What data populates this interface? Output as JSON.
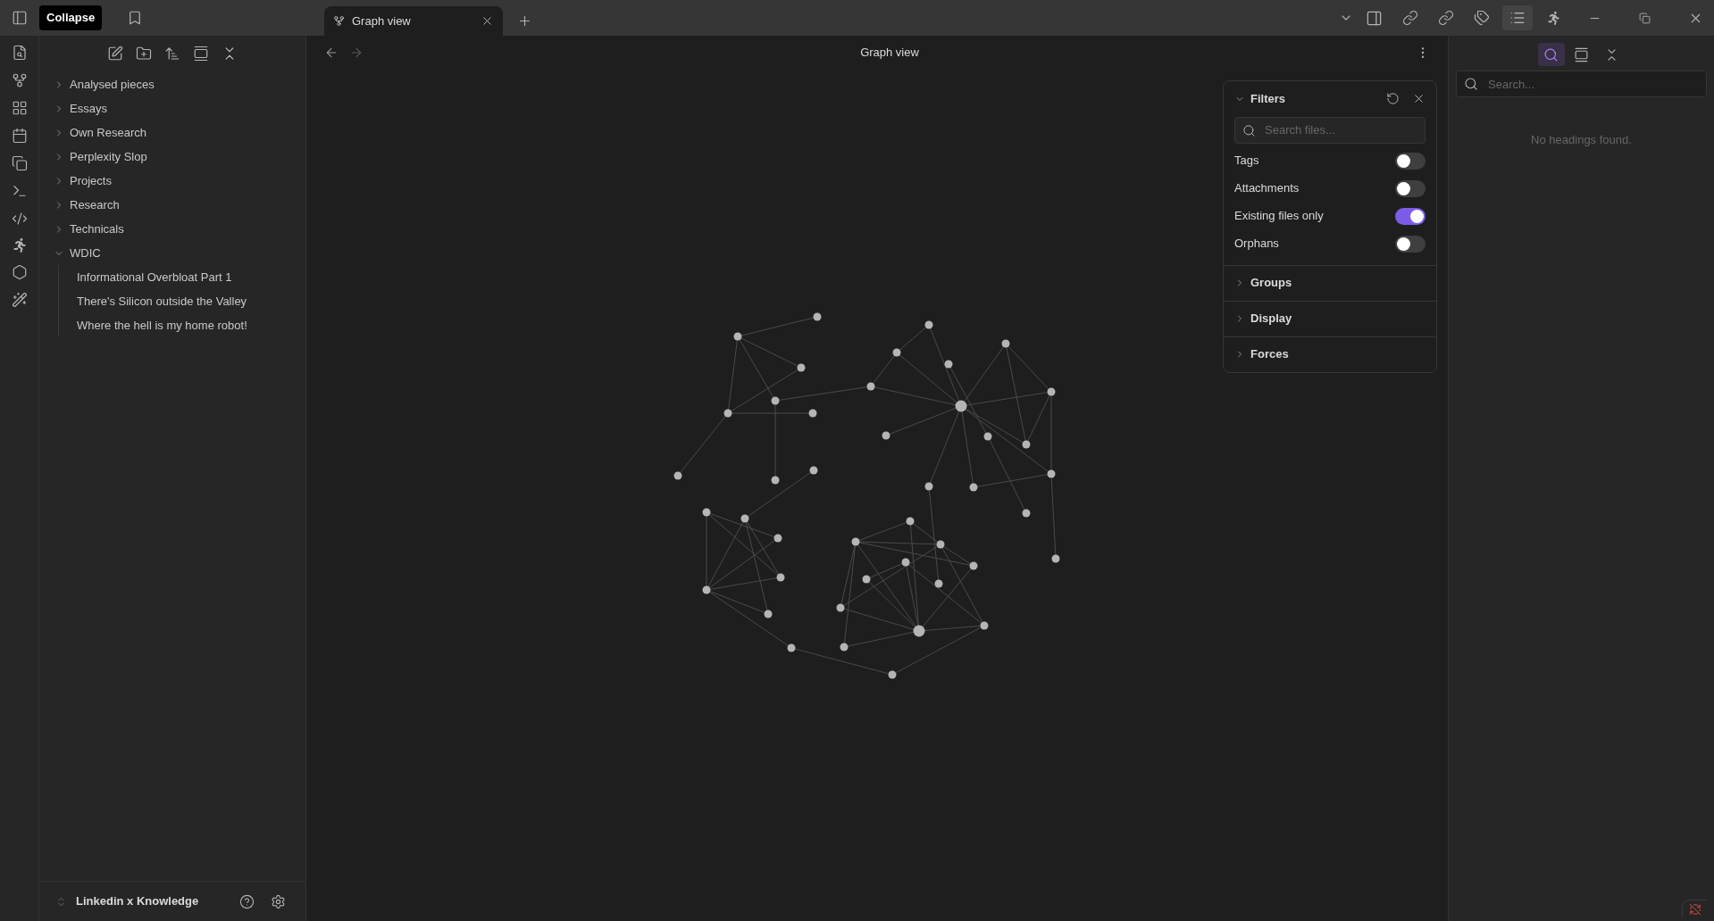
{
  "titlebar": {
    "tooltip": "Collapse",
    "tabs": [
      {
        "label": "Graph view",
        "selected": true
      }
    ],
    "sidebar_tabs": [
      {
        "kind": "backlinks",
        "selected": false
      },
      {
        "kind": "outgoing",
        "selected": false
      },
      {
        "kind": "tags",
        "selected": false
      },
      {
        "kind": "outline",
        "selected": true
      },
      {
        "kind": "runner",
        "selected": false
      }
    ]
  },
  "file_tree": [
    {
      "label": "Analysed pieces",
      "expanded": false
    },
    {
      "label": "Essays",
      "expanded": false
    },
    {
      "label": "Own Research",
      "expanded": false
    },
    {
      "label": "Perplexity Slop",
      "expanded": false
    },
    {
      "label": "Projects",
      "expanded": false
    },
    {
      "label": "Research",
      "expanded": false
    },
    {
      "label": "Technicals",
      "expanded": false
    },
    {
      "label": "WDIC",
      "expanded": true,
      "children": [
        {
          "label": "Informational Overbloat Part 1"
        },
        {
          "label": "There's Silicon outside the Valley"
        },
        {
          "label": "Where the hell is my home robot!"
        }
      ]
    }
  ],
  "vault": {
    "name": "Linkedin x Knowledge"
  },
  "graph_view": {
    "title": "Graph view"
  },
  "filters": {
    "title": "Filters",
    "expanded": true,
    "search": {
      "placeholder": "Search files..."
    },
    "toggles": [
      {
        "label": "Tags",
        "on": false
      },
      {
        "label": "Attachments",
        "on": false
      },
      {
        "label": "Existing files only",
        "on": true
      },
      {
        "label": "Orphans",
        "on": false
      }
    ],
    "sections": [
      {
        "label": "Groups",
        "expanded": false
      },
      {
        "label": "Display",
        "expanded": false
      },
      {
        "label": "Forces",
        "expanded": false
      }
    ]
  },
  "outline": {
    "tools": [
      {
        "kind": "search",
        "selected": true
      },
      {
        "kind": "expand",
        "selected": false
      },
      {
        "kind": "collapse",
        "selected": false
      }
    ],
    "search": {
      "placeholder": "Search..."
    },
    "empty_message": "No headings found."
  }
}
